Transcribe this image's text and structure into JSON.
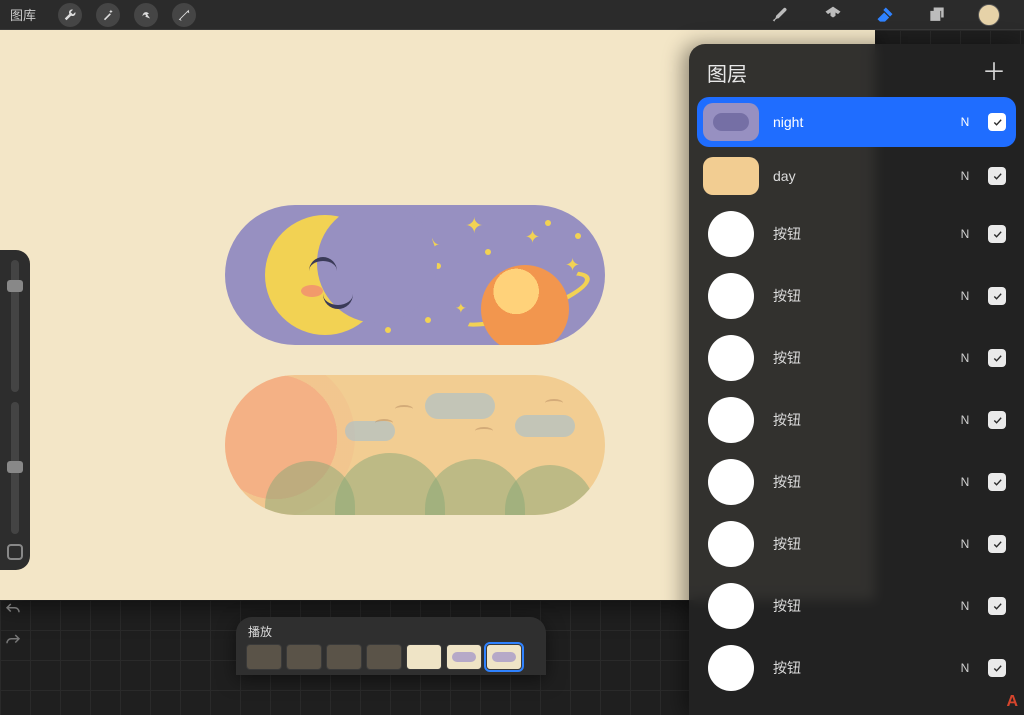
{
  "topbar": {
    "gallery_label": "图库"
  },
  "playbar": {
    "label": "播放"
  },
  "layers_panel": {
    "title": "图层",
    "items": [
      {
        "name": "night",
        "blend": "N",
        "selected": true,
        "thumb": "night"
      },
      {
        "name": "day",
        "blend": "N",
        "selected": false,
        "thumb": "day"
      },
      {
        "name": "按钮",
        "blend": "N",
        "selected": false,
        "thumb": "circle"
      },
      {
        "name": "按钮",
        "blend": "N",
        "selected": false,
        "thumb": "circle"
      },
      {
        "name": "按钮",
        "blend": "N",
        "selected": false,
        "thumb": "circle"
      },
      {
        "name": "按钮",
        "blend": "N",
        "selected": false,
        "thumb": "circle"
      },
      {
        "name": "按钮",
        "blend": "N",
        "selected": false,
        "thumb": "circle"
      },
      {
        "name": "按钮",
        "blend": "N",
        "selected": false,
        "thumb": "circle"
      },
      {
        "name": "按钮",
        "blend": "N",
        "selected": false,
        "thumb": "circle"
      },
      {
        "name": "按钮",
        "blend": "N",
        "selected": false,
        "thumb": "circle"
      }
    ]
  },
  "watermark": "A"
}
